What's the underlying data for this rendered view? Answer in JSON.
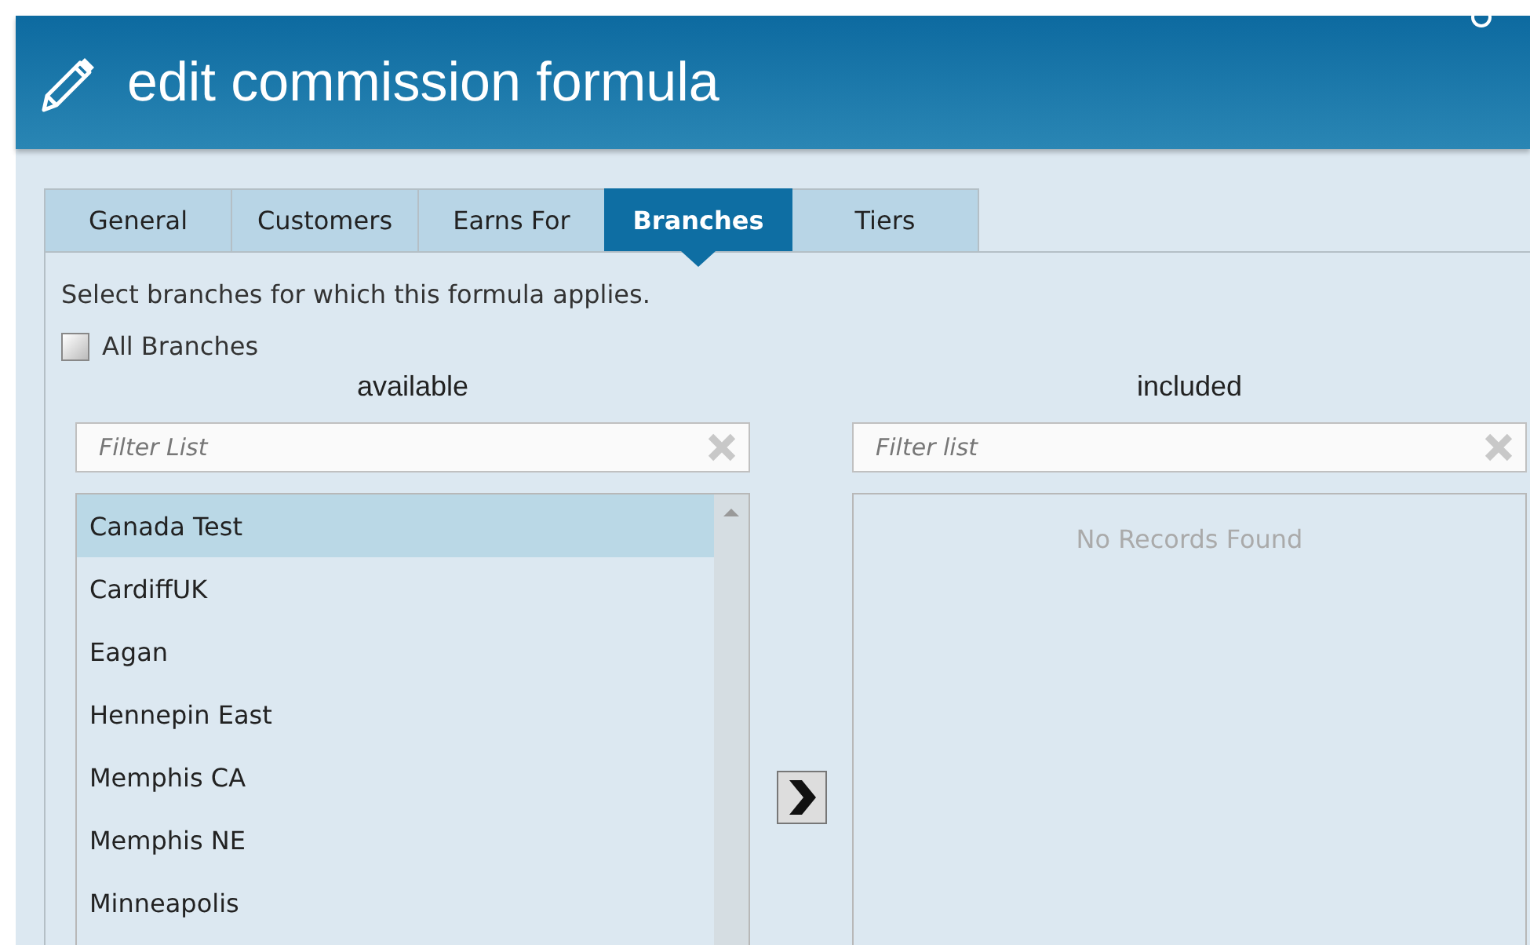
{
  "window": {
    "title": "edit commission formula"
  },
  "tabs": [
    {
      "label": "General",
      "selected": false
    },
    {
      "label": "Customers",
      "selected": false
    },
    {
      "label": "Earns For",
      "selected": false
    },
    {
      "label": "Branches",
      "selected": true
    },
    {
      "label": "Tiers",
      "selected": false
    }
  ],
  "description": "Select branches for which this formula applies.",
  "all_branches": {
    "label": "All Branches",
    "checked": false
  },
  "available": {
    "heading": "available",
    "filter": {
      "placeholder": "Filter List"
    },
    "items": [
      {
        "label": "Canada Test",
        "selected": true
      },
      {
        "label": "CardiffUK",
        "selected": false
      },
      {
        "label": "Eagan",
        "selected": false
      },
      {
        "label": "Hennepin East",
        "selected": false
      },
      {
        "label": "Memphis CA",
        "selected": false
      },
      {
        "label": "Memphis NE",
        "selected": false
      },
      {
        "label": "Minneapolis",
        "selected": false
      }
    ]
  },
  "included": {
    "heading": "included",
    "filter": {
      "placeholder": "Filter list"
    },
    "empty_message": "No Records Found"
  }
}
